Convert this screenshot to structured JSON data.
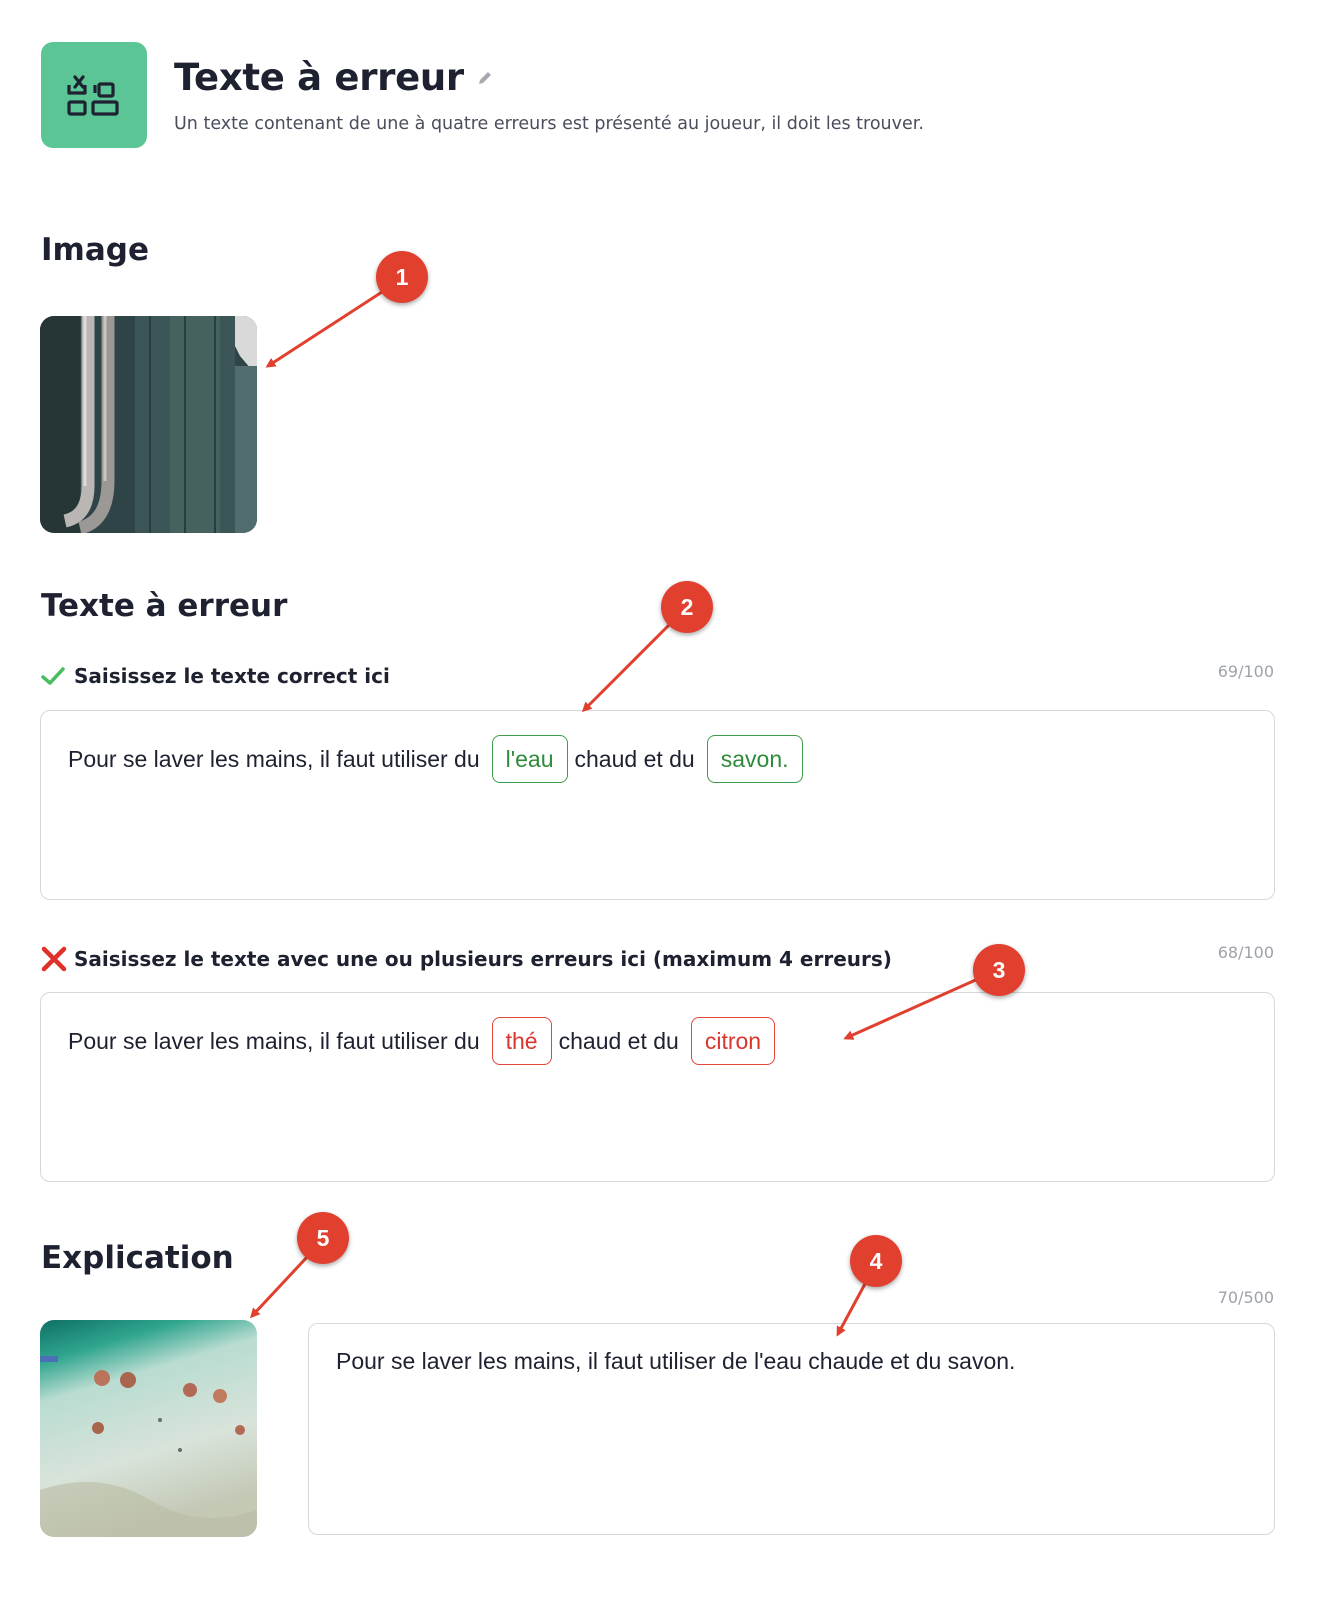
{
  "header": {
    "icon": "layout-grid-icon",
    "title": "Texte à erreur",
    "subtitle": "Un texte contenant de une à quatre erreurs est présenté au joueur, il doit les trouver."
  },
  "image_section": {
    "title": "Image"
  },
  "error_text_section": {
    "title": "Texte à erreur",
    "correct_field": {
      "label": "Saisissez le texte correct ici",
      "counter": "69/100",
      "text_before": "Pour se laver les mains, il faut utiliser du",
      "word1": "l'eau",
      "text_middle": "chaud et du",
      "word2": "savon."
    },
    "error_field": {
      "label": "Saisissez le texte avec une ou plusieurs erreurs ici (maximum 4 erreurs)",
      "counter": "68/100",
      "text_before": "Pour se laver les mains, il faut utiliser du",
      "word1": "thé",
      "text_middle": "chaud et du",
      "word2": "citron"
    }
  },
  "explanation_section": {
    "title": "Explication",
    "counter": "70/500",
    "text": "Pour se laver les mains, il faut utiliser de l'eau chaude et du savon."
  },
  "annotations": [
    "1",
    "2",
    "3",
    "4",
    "5"
  ],
  "colors": {
    "brand_green": "#5bc595",
    "correct_green": "#2e8b3a",
    "error_red": "#d9362c",
    "annotation_red": "#e2402f"
  }
}
